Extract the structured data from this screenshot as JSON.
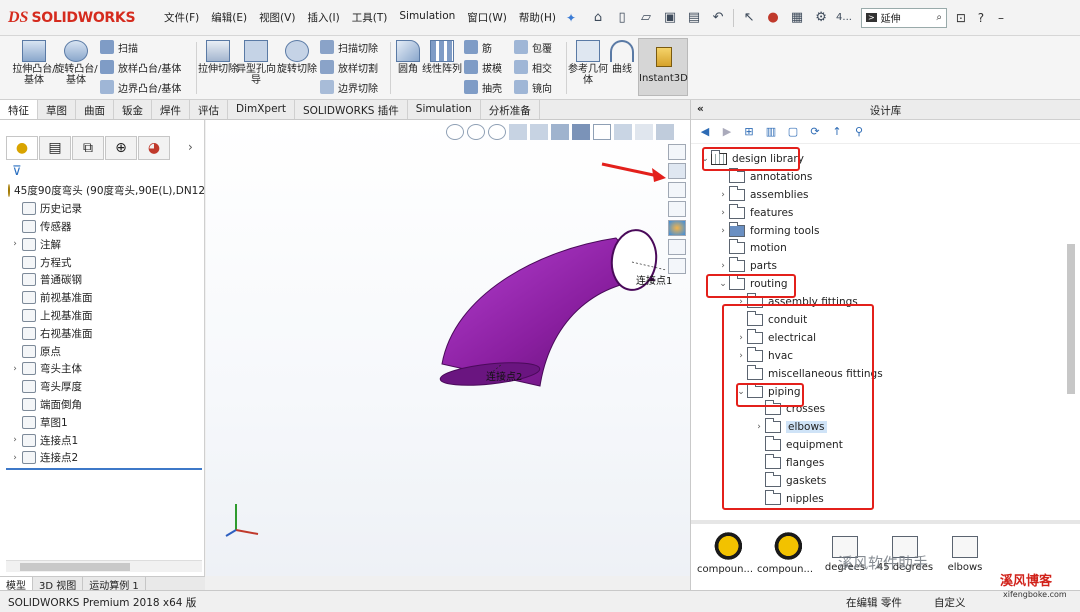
{
  "app": {
    "logo_mark": "DS",
    "logo_text": "SOLIDWORKS",
    "menu": [
      "文件(F)",
      "编辑(E)",
      "视图(V)",
      "插入(I)",
      "工具(T)",
      "Simulation",
      "窗口(W)",
      "帮助(H)"
    ],
    "search_arrow": ">",
    "search_text": "延伸",
    "toolbar_num": "4..."
  },
  "ribbon": {
    "extrude_boss": "拉伸凸台/基体",
    "revolve_boss": "旋转凸台/基体",
    "sweep": "扫描",
    "loft_boss": "放样凸台/基体",
    "boundary_boss": "边界凸台/基体",
    "extrude_cut": "拉伸切除",
    "hole_wizard": "异型孔向导",
    "revolve_cut": "旋转切除",
    "swept_cut": "扫描切除",
    "lofted_cut": "放样切割",
    "boundary_cut": "边界切除",
    "fillet": "圆角",
    "linear_pattern": "线性阵列",
    "rib": "筋",
    "draft": "拔模",
    "shell": "抽壳",
    "wrap": "包覆",
    "intersect": "相交",
    "mirror": "镜向",
    "ref_geometry": "参考几何体",
    "curves": "曲线",
    "instant3d": "Instant3D"
  },
  "tabs": [
    "特征",
    "草图",
    "曲面",
    "钣金",
    "焊件",
    "评估",
    "DimXpert",
    "SOLIDWORKS 插件",
    "Simulation",
    "分析准备"
  ],
  "feature_tree": {
    "root": "45度90度弯头 (90度弯头,90E(L),DN12",
    "items": [
      {
        "label": "历史记录",
        "exp": ""
      },
      {
        "label": "传感器",
        "exp": ""
      },
      {
        "label": "注解",
        "exp": "›"
      },
      {
        "label": "方程式",
        "exp": ""
      },
      {
        "label": "普通碳钢",
        "exp": ""
      },
      {
        "label": "前视基准面",
        "exp": ""
      },
      {
        "label": "上视基准面",
        "exp": ""
      },
      {
        "label": "右视基准面",
        "exp": ""
      },
      {
        "label": "原点",
        "exp": ""
      },
      {
        "label": "弯头主体",
        "exp": "›"
      },
      {
        "label": "弯头厚度",
        "exp": ""
      },
      {
        "label": "端面倒角",
        "exp": ""
      },
      {
        "label": "草图1",
        "exp": ""
      },
      {
        "label": "连接点1",
        "exp": "›"
      },
      {
        "label": "连接点2",
        "exp": "›"
      }
    ]
  },
  "viewport": {
    "cpoint_label_1": "连接点1",
    "cpoint_label_2": "连接点2",
    "part_color": "#8a1fa0"
  },
  "bottom_tabs": [
    "模型",
    "3D 视图",
    "运动算例 1"
  ],
  "status": {
    "product": "SOLIDWORKS Premium 2018 x64 版",
    "editing": "在编辑 零件",
    "custom": "自定义"
  },
  "design_library": {
    "title": "设计库",
    "collapse": "«",
    "tree": [
      {
        "label": "design library",
        "exp": "⌄",
        "indent": 8,
        "icon": "lib"
      },
      {
        "label": "annotations",
        "exp": "",
        "indent": 26,
        "icon": "folder"
      },
      {
        "label": "assemblies",
        "exp": "›",
        "indent": 26,
        "icon": "folder"
      },
      {
        "label": "features",
        "exp": "›",
        "indent": 26,
        "icon": "folder"
      },
      {
        "label": "forming tools",
        "exp": "›",
        "indent": 26,
        "icon": "tool"
      },
      {
        "label": "motion",
        "exp": "",
        "indent": 26,
        "icon": "folder"
      },
      {
        "label": "parts",
        "exp": "›",
        "indent": 26,
        "icon": "folder"
      },
      {
        "label": "routing",
        "exp": "⌄",
        "indent": 26,
        "icon": "folder"
      },
      {
        "label": "assembly fittings",
        "exp": "›",
        "indent": 44,
        "icon": "folder"
      },
      {
        "label": "conduit",
        "exp": "",
        "indent": 44,
        "icon": "folder"
      },
      {
        "label": "electrical",
        "exp": "›",
        "indent": 44,
        "icon": "folder"
      },
      {
        "label": "hvac",
        "exp": "›",
        "indent": 44,
        "icon": "folder"
      },
      {
        "label": "miscellaneous fittings",
        "exp": "",
        "indent": 44,
        "icon": "folder"
      },
      {
        "label": "piping",
        "exp": "⌄",
        "indent": 44,
        "icon": "folder"
      },
      {
        "label": "crosses",
        "exp": "",
        "indent": 62,
        "icon": "folder"
      },
      {
        "label": "elbows",
        "exp": "›",
        "indent": 62,
        "icon": "folder",
        "selected": true
      },
      {
        "label": "equipment",
        "exp": "",
        "indent": 62,
        "icon": "folder"
      },
      {
        "label": "flanges",
        "exp": "",
        "indent": 62,
        "icon": "folder"
      },
      {
        "label": "gaskets",
        "exp": "",
        "indent": 62,
        "icon": "folder"
      },
      {
        "label": "nipples",
        "exp": "",
        "indent": 62,
        "icon": "folder"
      }
    ],
    "preview": [
      "compoun...",
      "compoun...",
      "degrees",
      "45 degrees",
      "elbows"
    ]
  },
  "watermark": {
    "line1": "溪风软件助手",
    "line2": "溪风博客",
    "line3": "xifengboke.com"
  },
  "colors": {
    "accent_red": "#e3201b",
    "solidworks_red": "#d52b1e",
    "part_purple": "#8a1fa0",
    "selection_blue": "#cfe3f7"
  }
}
